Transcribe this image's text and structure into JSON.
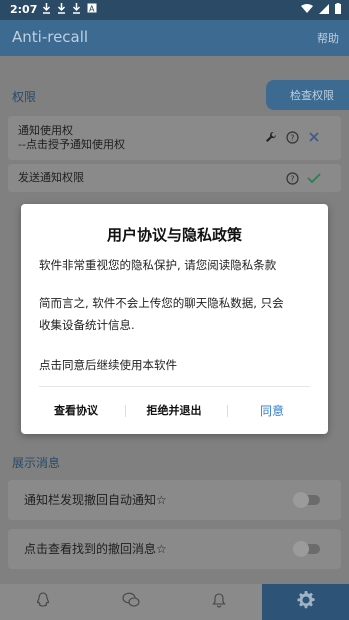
{
  "status_bar": {
    "time": "2:07"
  },
  "app_bar": {
    "title": "Anti-recall",
    "help": "帮助"
  },
  "permissions": {
    "section_title": "权限",
    "check_button": "检查权限",
    "rows": [
      {
        "label_line1": "通知使用权",
        "label_line2": "--点击授予通知使用权"
      },
      {
        "label_line1": "发送通知权限"
      }
    ]
  },
  "display": {
    "section_title": "展示消息",
    "rows": [
      {
        "label": "通知栏发现撤回自动通知☆"
      },
      {
        "label": "点击查看找到的撤回消息☆"
      }
    ]
  },
  "dialog": {
    "title": "用户协议与隐私政策",
    "paragraph1": "软件非常重视您的隐私保护, 请您阅读隐私条款",
    "paragraph2a": "简而言之, 软件不会上传您的聊天隐私数据, 只会",
    "paragraph2b": "收集设备统计信息.",
    "paragraph3": "点击同意后继续使用本软件",
    "buttons": {
      "view": "查看协议",
      "decline": "拒绝并退出",
      "agree": "同意"
    }
  },
  "colors": {
    "primary": "#3d6a91",
    "accent_blue": "#2f7bd6",
    "check_green": "#2e7d4f"
  }
}
